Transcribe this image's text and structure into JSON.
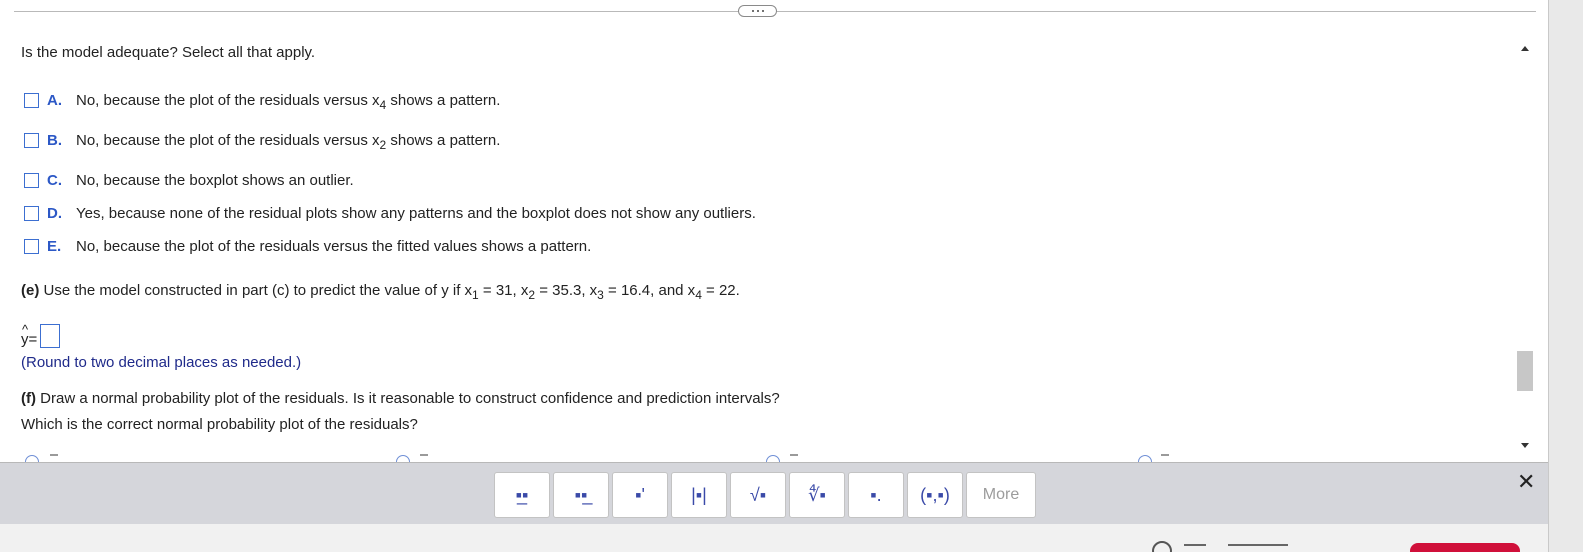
{
  "question": "Is the model adequate? Select all that apply.",
  "options": [
    {
      "letter": "A.",
      "pre": "No, because the plot of the residuals versus x",
      "sub": "4",
      "post": " shows a pattern."
    },
    {
      "letter": "B.",
      "pre": "No, because the plot of the residuals versus x",
      "sub": "2",
      "post": " shows a pattern."
    },
    {
      "letter": "C.",
      "text": "No, because the boxplot shows an outlier."
    },
    {
      "letter": "D.",
      "text": "Yes, because none of the residual plots show any patterns and the boxplot does not show any outliers."
    },
    {
      "letter": "E.",
      "text": "No, because the plot of the residuals versus the fitted values shows a pattern."
    }
  ],
  "part_e": {
    "label": "(e)",
    "t1": " Use the model constructed in part (c) to predict the value of y if x",
    "s1": "1",
    "t2": " = 31, x",
    "s2": "2",
    "t3": " = 35.3, x",
    "s3": "3",
    "t4": " = 16.4, and x",
    "s4": "4",
    "t5": " = 22."
  },
  "answer": {
    "yhat_var": "y",
    "yhat_hat": "^",
    "equals": " =",
    "value": "",
    "note": "(Round to two decimal places as needed.)"
  },
  "part_f": {
    "label": "(f)",
    "line1": " Draw a normal probability plot of the residuals. Is it reasonable to construct confidence and prediction intervals?",
    "line2": "Which is the correct normal probability plot of the residuals?"
  },
  "toolbar": {
    "buttons": [
      {
        "name": "fraction-tool",
        "symbol": "▪̲▪"
      },
      {
        "name": "mixed-number-tool",
        "symbol": "▪▪̲"
      },
      {
        "name": "exponent-tool",
        "symbol": "▪'"
      },
      {
        "name": "absolute-value-tool",
        "symbol": "|▪|"
      },
      {
        "name": "square-root-tool",
        "symbol": "√▪"
      },
      {
        "name": "nth-root-tool",
        "symbol": "∜▪"
      },
      {
        "name": "decimal-tool",
        "symbol": "▪."
      },
      {
        "name": "ordered-pair-tool",
        "symbol": "(▪,▪)"
      }
    ],
    "more_label": "More",
    "close_symbol": "✕"
  },
  "colors": {
    "accent": "#2c58c6",
    "note": "#1f2a8a",
    "toolbar_bg": "#d5d6db",
    "scroll_thumb": "#c7c7c7"
  },
  "icons": [
    "ellipsis-icon",
    "checkbox-icon",
    "scroll-up-icon",
    "scroll-down-icon",
    "close-icon",
    "radio-icon"
  ]
}
